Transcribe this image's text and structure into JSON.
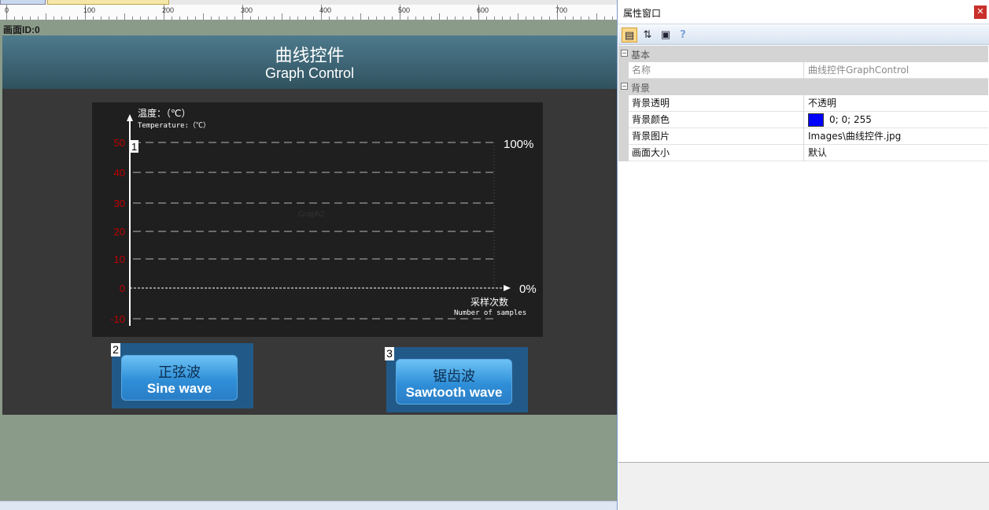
{
  "canvas": {
    "ruler": {
      "labels": [
        "0",
        "100",
        "200",
        "300",
        "400",
        "500",
        "600",
        "700"
      ]
    },
    "screen_id_label": "画面ID:0",
    "screen": {
      "title_cn": "曲线控件",
      "title_en": "Graph Control",
      "graph": {
        "id_badge": "1",
        "control_name": "Graph2",
        "y_axis_title_cn": "温度：（℃）",
        "y_axis_title_en": "Temperature:（℃）",
        "x_axis_title_cn": "采样次数",
        "x_axis_title_en": "Number of samples",
        "right_top_label": "100%",
        "right_bottom_label": "0%",
        "y_tick_labels": [
          "50",
          "40",
          "30",
          "20",
          "10",
          "0",
          "-10"
        ],
        "tick_color": "#c00000"
      },
      "buttons": [
        {
          "badge": "2",
          "label_cn": "正弦波",
          "label_en": "Sine wave"
        },
        {
          "badge": "3",
          "label_cn": "锯齿波",
          "label_en": "Sawtooth wave"
        }
      ]
    }
  },
  "property_window": {
    "title": "属性窗口",
    "close_icon": "close-icon",
    "toolbar": [
      "categorized-icon",
      "sort-az-icon",
      "property-pages-icon",
      "help-icon"
    ],
    "categories": [
      {
        "label": "基本",
        "rows": [
          {
            "name": "名称",
            "value": "曲线控件GraphControl",
            "readonly": true
          }
        ]
      },
      {
        "label": "背景",
        "rows": [
          {
            "name": "背景透明",
            "value": "不透明"
          },
          {
            "name": "背景颜色",
            "value": "0; 0; 255",
            "swatch": "#0000ff"
          },
          {
            "name": "背景图片",
            "value": "Images\\曲线控件.jpg"
          },
          {
            "name": "画面大小",
            "value": "默认"
          }
        ]
      }
    ]
  }
}
